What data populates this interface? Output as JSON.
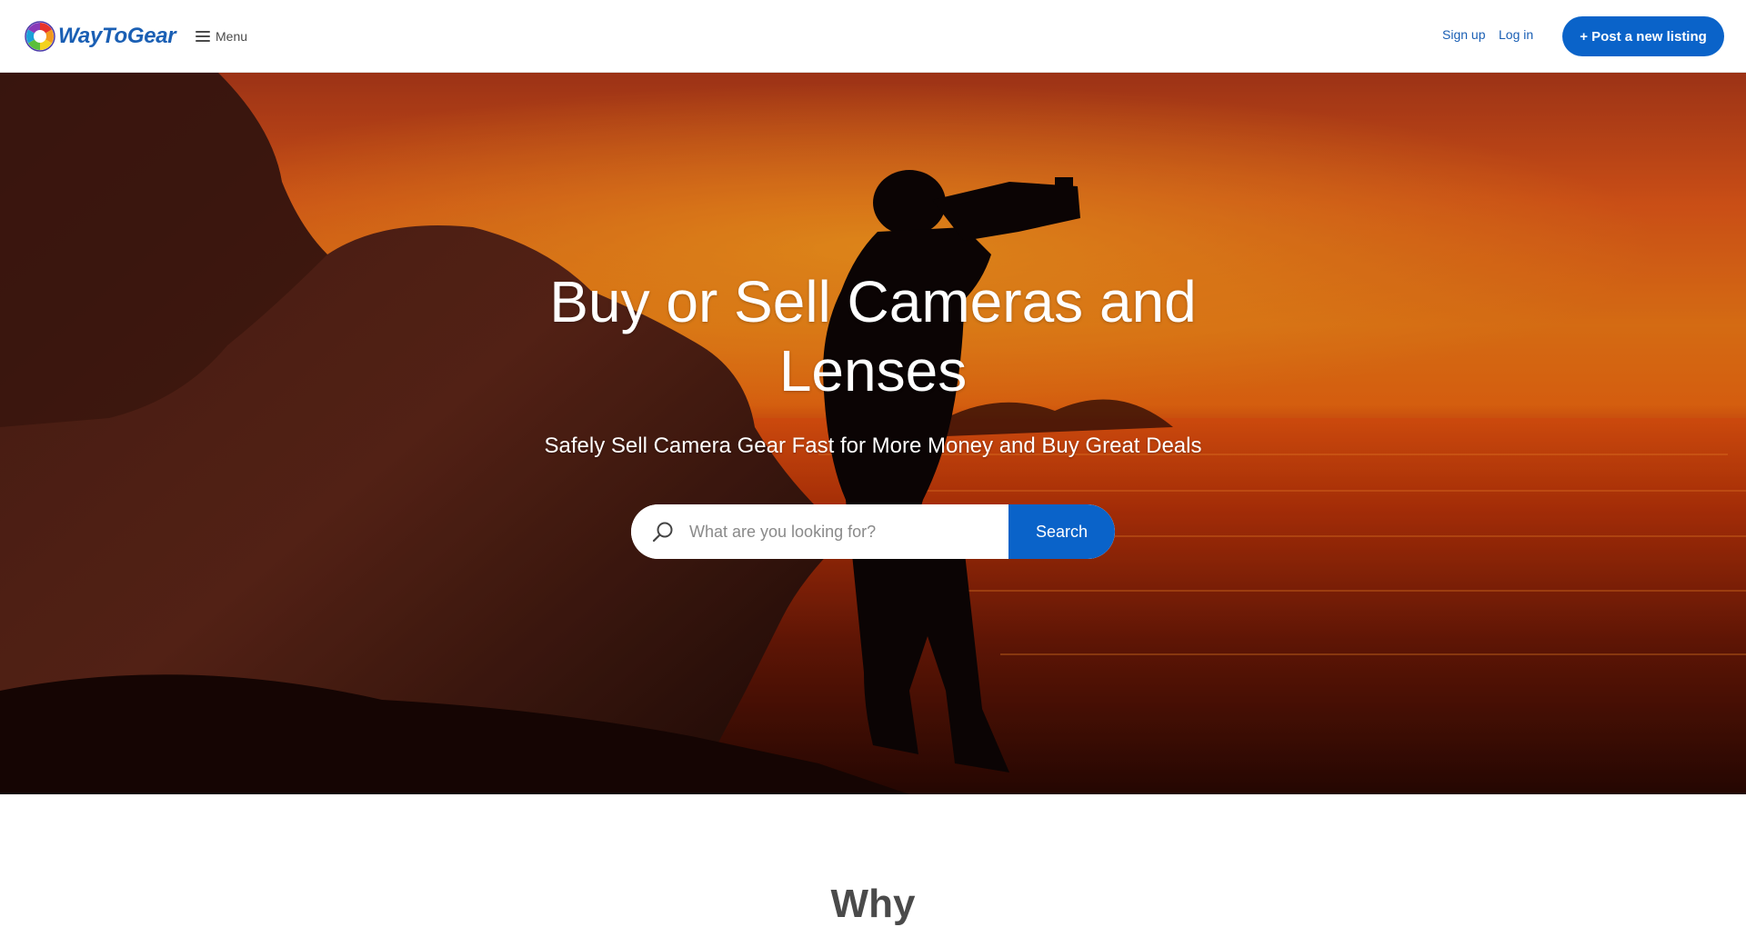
{
  "brand": {
    "name": "WayToGear",
    "accent_color": "#0a63c9",
    "logo_icon": "color-wheel-aperture-icon"
  },
  "topbar": {
    "menu_label": "Menu",
    "menu_icon": "hamburger-menu-icon",
    "signup_label": "Sign up",
    "login_label": "Log in",
    "post_listing_label": "+ Post a new listing"
  },
  "hero": {
    "title": "Buy or Sell Cameras and Lenses",
    "subtitle": "Safely Sell Camera Gear Fast for More Money and Buy Great Deals",
    "background": "photographer-silhouette-at-sunset-sea-rocks",
    "search": {
      "icon": "search-icon",
      "placeholder": "What are you looking for?",
      "value": "",
      "button_label": "Search"
    }
  },
  "next_section": {
    "heading": "Why"
  }
}
